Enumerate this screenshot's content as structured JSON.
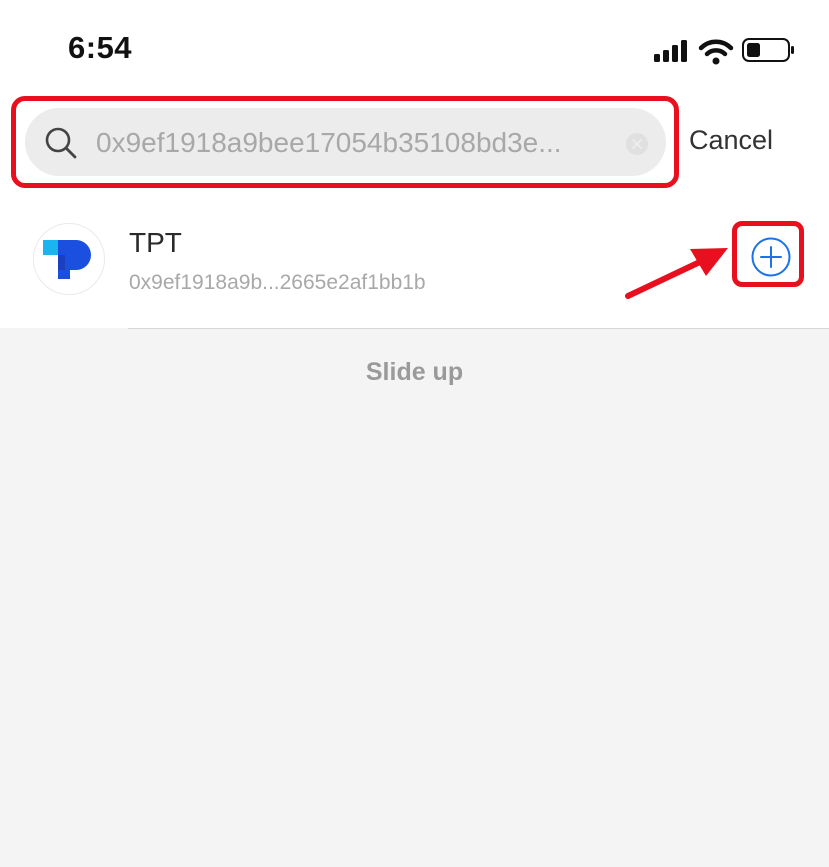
{
  "status_bar": {
    "time": "6:54",
    "icons": [
      "cellular-signal-icon",
      "wifi-icon",
      "battery-icon"
    ]
  },
  "search": {
    "value": "0x9ef1918a9bee17054b35108bd3e...",
    "icon": "search-icon",
    "clear_icon": "clear-icon",
    "cancel_label": "Cancel"
  },
  "results": [
    {
      "name": "TPT",
      "address": "0x9ef1918a9b...2665e2af1bb1b",
      "logo_icon": "tpt-logo-icon",
      "action_icon": "add-circle-icon"
    }
  ],
  "footer": {
    "slide_hint": "Slide up"
  },
  "colors": {
    "highlight": "#e8101e",
    "accent_blue": "#1a73e8",
    "background": "#f4f4f4"
  }
}
